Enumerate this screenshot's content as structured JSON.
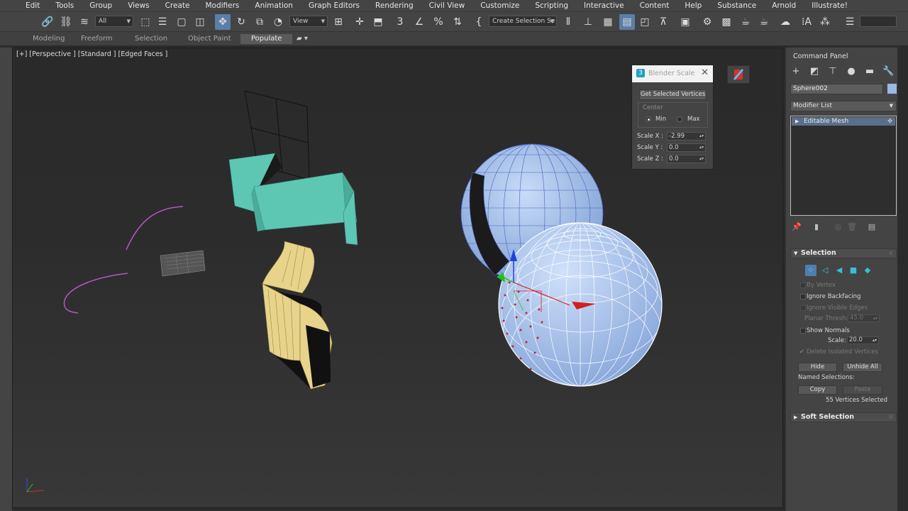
{
  "menu": [
    "Edit",
    "Tools",
    "Group",
    "Views",
    "Create",
    "Modifiers",
    "Animation",
    "Graph Editors",
    "Rendering",
    "Civil View",
    "Customize",
    "Scripting",
    "Interactive",
    "Content",
    "Help",
    "Substance",
    "Arnold",
    "Illustrate!"
  ],
  "toolbar": {
    "filter_value": "All",
    "refcoord_value": "View",
    "named_selection_value": "Create Selection Se"
  },
  "ribbon": {
    "tabs": [
      "Modeling",
      "Freeform",
      "Selection",
      "Object Paint",
      "Populate"
    ],
    "selected": "Populate"
  },
  "viewport": {
    "label": "[+] [Perspective ] [Standard ] [Edged Faces ]"
  },
  "dialog": {
    "title": "Blender Scale",
    "get_button": "Get Selected Vertices",
    "center_label": "Center",
    "min_label": "Min",
    "max_label": "Max",
    "scale_x_label": "Scale X  :",
    "scale_x": "-2.99",
    "scale_y_label": "Scale Y  :",
    "scale_y": "0.0",
    "scale_z_label": "Scale Z  :",
    "scale_z": "0.0"
  },
  "command_panel": {
    "title": "Command Panel",
    "object_name": "Sphere002",
    "object_color": "#9ab8e6",
    "modifier_list": "Modifier List",
    "stack_item": "Editable Mesh",
    "selection": {
      "header": "Selection",
      "by_vertex": "By Vertex",
      "ignore_backfacing": "Ignore Backfacing",
      "ignore_visible_edges": "Ignore Visible Edges",
      "planar_thresh_label": "Planar Thresh:",
      "planar_thresh": "45.0",
      "show_normals": "Show Normals",
      "scale_label": "Scale:",
      "scale": "20.0",
      "delete_isolated": "Delete Isolated Vertices",
      "hide": "Hide",
      "unhide_all": "Unhide All",
      "named_selections": "Named Selections:",
      "copy": "Copy",
      "paste": "Paste",
      "status": "55 Vertices Selected"
    },
    "soft_selection": "Soft Selection"
  },
  "colors": {
    "teal_object": "#5ec7b4",
    "yellow_surface": "#e8d38a",
    "sphere_blue": "#9ab8e6",
    "spline_purple": "#b05ac0",
    "accent_blue": "#5a7fa8"
  }
}
